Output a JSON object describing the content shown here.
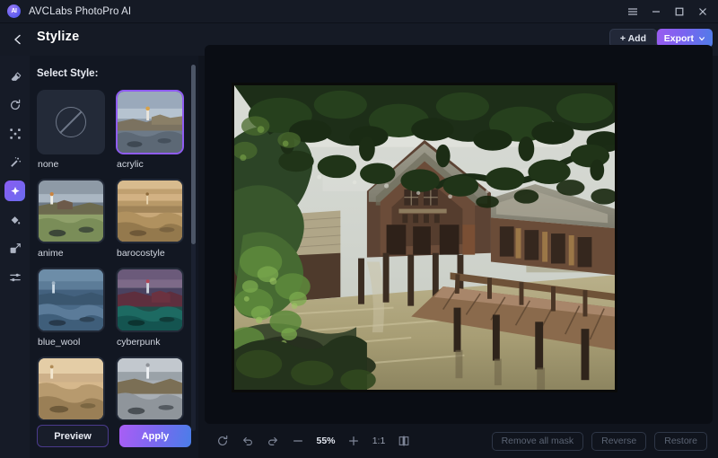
{
  "titlebar": {
    "app_name": "AVCLabs PhotoPro AI",
    "logo_text": "AI",
    "menu_icon": "hamburger-menu-icon",
    "minimize_icon": "minimize-icon",
    "maximize_icon": "maximize-icon",
    "close_icon": "close-icon"
  },
  "header": {
    "back_icon": "chevron-left-icon",
    "title": "Stylize",
    "add_label": "+ Add",
    "export_label": "Export",
    "export_chevron": "chevron-down-icon"
  },
  "tool_rail": {
    "items": [
      {
        "name": "eraser-tool",
        "active": false
      },
      {
        "name": "refresh-tool",
        "active": false
      },
      {
        "name": "expand-tool",
        "active": false
      },
      {
        "name": "magic-wand-tool",
        "active": false
      },
      {
        "name": "stylize-tool",
        "active": true
      },
      {
        "name": "paint-bucket-tool",
        "active": false
      },
      {
        "name": "resize-tool",
        "active": false
      },
      {
        "name": "adjustments-tool",
        "active": false
      }
    ]
  },
  "style_panel": {
    "label": "Select Style:",
    "styles": [
      {
        "name": "none",
        "selected": false
      },
      {
        "name": "acrylic",
        "selected": true
      },
      {
        "name": "anime",
        "selected": false
      },
      {
        "name": "barocostyle",
        "selected": false
      },
      {
        "name": "blue_wool",
        "selected": false
      },
      {
        "name": "cyberpunk",
        "selected": false
      },
      {
        "name": "",
        "selected": false
      },
      {
        "name": "",
        "selected": false
      }
    ],
    "preview_label": "Preview",
    "apply_label": "Apply"
  },
  "bottombar": {
    "reset_icon": "reset-icon",
    "undo_icon": "undo-icon",
    "redo_icon": "redo-icon",
    "zoom_out_icon": "minus-icon",
    "zoom_level": "55%",
    "zoom_in_icon": "plus-icon",
    "fit_ratio": "1:1",
    "compare_icon": "compare-split-icon",
    "remove_all_mask_label": "Remove all mask",
    "reverse_label": "Reverse",
    "restore_label": "Restore"
  },
  "colors": {
    "accent_purple": "#8f5cf2",
    "accent_blue": "#4a7ee8",
    "window_bg": "#151a25",
    "panel_bg": "#121722",
    "canvas_bg": "#0a0d14"
  }
}
